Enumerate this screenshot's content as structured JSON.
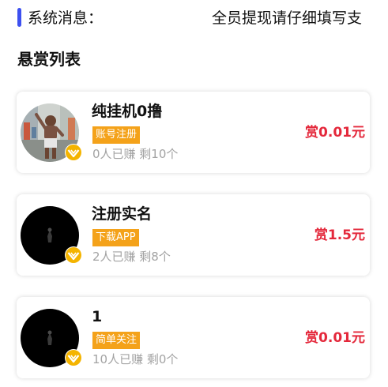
{
  "notice": {
    "label": "系统消息：",
    "message": "全员提现请仔细填写支"
  },
  "section": {
    "title": "悬赏列表"
  },
  "tasks": [
    {
      "title": "纯挂机0撸",
      "tag": "账号注册",
      "stats": "0人已赚 剩10个",
      "reward": "赏0.01元",
      "avatar": "person-photo"
    },
    {
      "title": "注册实名",
      "tag": "下载APP",
      "stats": "2人已赚 剩8个",
      "reward": "赏1.5元",
      "avatar": "dark-figure"
    },
    {
      "title": "1",
      "tag": "简单关注",
      "stats": "10人已赚 剩0个",
      "reward": "赏0.01元",
      "avatar": "dark-figure"
    }
  ],
  "colors": {
    "accent": "#3d50f0",
    "tag": "#f4a21a",
    "reward": "#e4283b",
    "badge": "#f4b400"
  }
}
